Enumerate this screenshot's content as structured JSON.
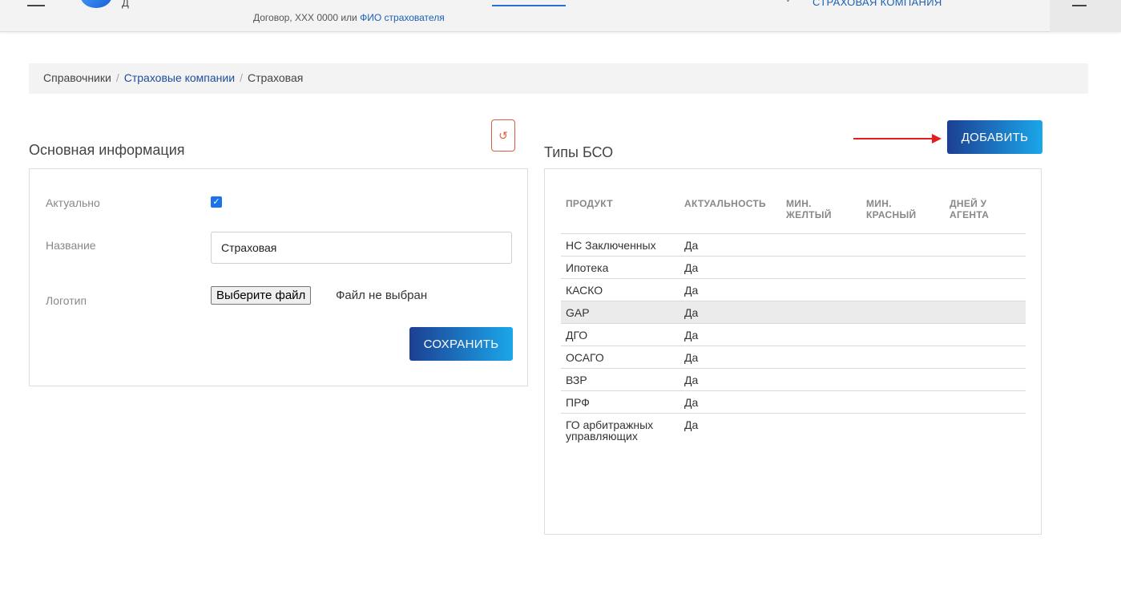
{
  "header": {
    "logo_letter": "Д",
    "search_hint_prefix": "Договор, XXX 0000 или ",
    "search_hint_link": "ФИО страхователя",
    "company_name": "СТРАХОВАЯ КОМПАНИЯ",
    "chevron": "v"
  },
  "breadcrumb": {
    "items": [
      "Справочники",
      "Страховые компании",
      "Страховая"
    ],
    "separator": "/"
  },
  "main_info": {
    "title": "Основная информация",
    "reset_icon": "↺",
    "fields": {
      "active_label": "Актуально",
      "active_checked": true,
      "name_label": "Название",
      "name_value": "Страховая",
      "logo_label": "Логотип",
      "file_button": "Выберите файл",
      "file_status": "Файл не выбран"
    },
    "save_label": "СОХРАНИТЬ"
  },
  "bso": {
    "title": "Типы БСО",
    "add_label": "ДОБАВИТЬ",
    "columns": [
      "ПРОДУКТ",
      "АКТУАЛЬНОСТЬ",
      "МИН. ЖЕЛТЫЙ",
      "МИН. КРАСНЫЙ",
      "ДНЕЙ У АГЕНТА"
    ],
    "rows": [
      {
        "product": "НС Заключенных",
        "active": "Да",
        "min_yellow": "",
        "min_red": "",
        "days": ""
      },
      {
        "product": "Ипотека",
        "active": "Да",
        "min_yellow": "",
        "min_red": "",
        "days": ""
      },
      {
        "product": "КАСКО",
        "active": "Да",
        "min_yellow": "",
        "min_red": "",
        "days": ""
      },
      {
        "product": "GAP",
        "active": "Да",
        "min_yellow": "",
        "min_red": "",
        "days": ""
      },
      {
        "product": "ДГО",
        "active": "Да",
        "min_yellow": "",
        "min_red": "",
        "days": ""
      },
      {
        "product": "ОСАГО",
        "active": "Да",
        "min_yellow": "",
        "min_red": "",
        "days": ""
      },
      {
        "product": "ВЗР",
        "active": "Да",
        "min_yellow": "",
        "min_red": "",
        "days": ""
      },
      {
        "product": "ПРФ",
        "active": "Да",
        "min_yellow": "",
        "min_red": "",
        "days": ""
      },
      {
        "product": "ГО арбитражных управляющих",
        "active": "Да",
        "min_yellow": "",
        "min_red": "",
        "days": ""
      }
    ],
    "hover_row": 3
  },
  "colors": {
    "accent_dark": "#1c3f93",
    "accent_light": "#1ba7ea",
    "reset_red": "#e05a40",
    "arrow_red": "#e31e1e"
  }
}
